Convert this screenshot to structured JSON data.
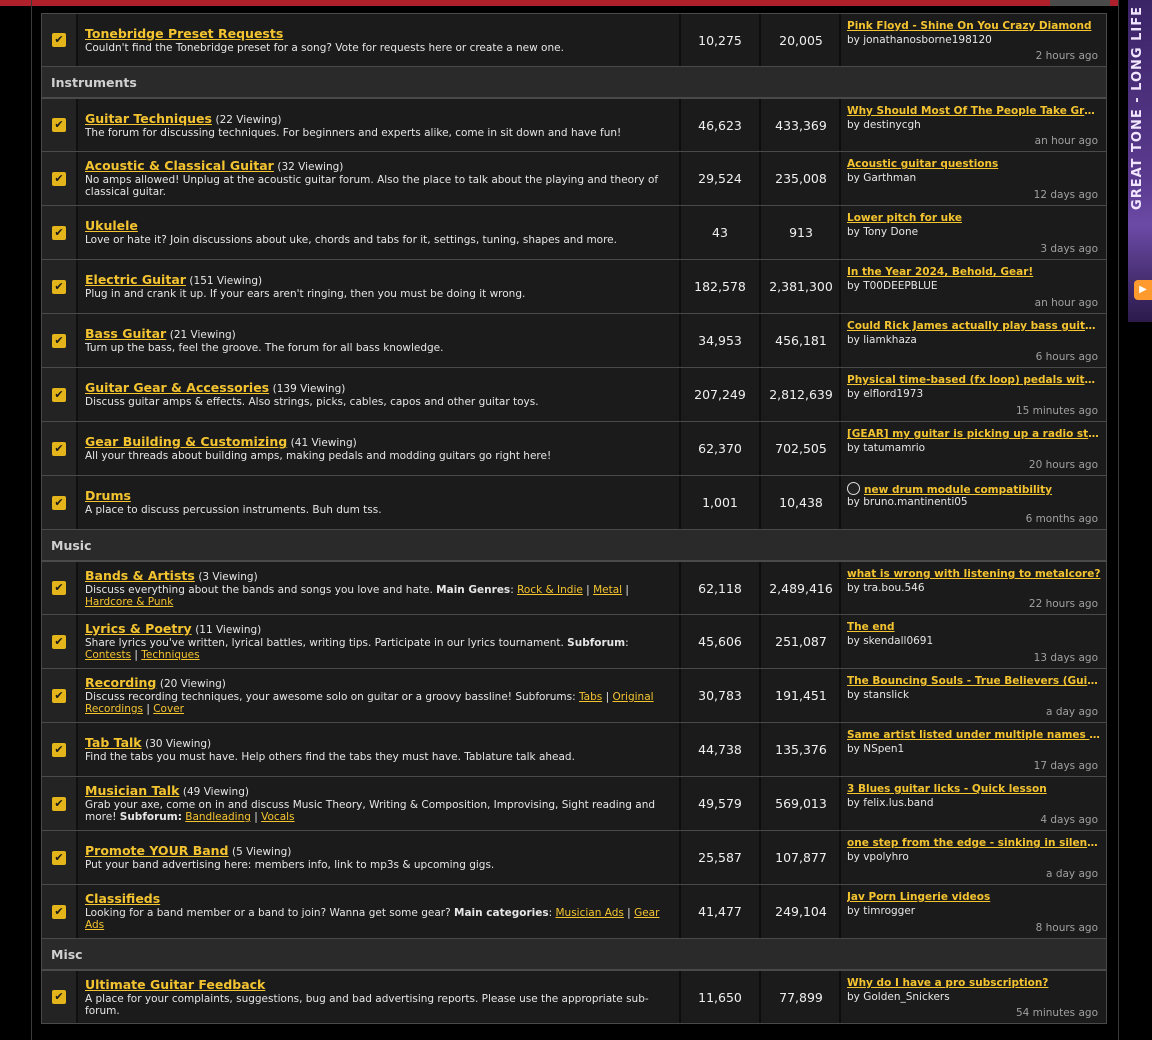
{
  "ad": {
    "text": "GREAT TONE - LONG LIFE"
  },
  "sections": [
    {
      "category": "",
      "forums": [
        {
          "title": "Tonebridge Preset Requests",
          "viewing": "",
          "desc": "Couldn't find the Tonebridge preset for a song? Vote for requests here or create a new one.",
          "threads": "10,275",
          "posts": "20,005",
          "last_title": "Pink Floyd - Shine On You Crazy Diamond",
          "last_by": "by jonathanosborne198120",
          "last_time": "2 hours ago"
        }
      ]
    },
    {
      "category": "Instruments",
      "forums": [
        {
          "title": "Guitar Techniques",
          "viewing": "(22 Viewing)",
          "desc": "The forum for discussing techniques. For beginners and experts alike, come in sit down and have fun!",
          "threads": "46,623",
          "posts": "433,369",
          "last_title": "Why Should Most Of The People Take Gro...",
          "last_by": "by destinycgh",
          "last_time": "an hour ago"
        },
        {
          "title": "Acoustic & Classical Guitar",
          "viewing": "(32 Viewing)",
          "desc": "No amps allowed! Unplug at the acoustic guitar forum. Also the place to talk about the playing and theory of classical guitar.",
          "threads": "29,524",
          "posts": "235,008",
          "last_title": "Acoustic guitar questions",
          "last_by": "by Garthman",
          "last_time": "12 days ago"
        },
        {
          "title": "Ukulele",
          "viewing": "",
          "desc": "Love or hate it? Join discussions about uke, chords and tabs for it, settings, tuning, shapes and more.",
          "threads": "43",
          "posts": "913",
          "last_title": "Lower pitch for uke",
          "last_by": "by Tony Done",
          "last_time": "3 days ago"
        },
        {
          "title": "Electric Guitar",
          "viewing": "(151 Viewing)",
          "desc": "Plug in and crank it up. If your ears aren't ringing, then you must be doing it wrong.",
          "threads": "182,578",
          "posts": "2,381,300",
          "last_title": "In the Year 2024, Behold, Gear!",
          "last_by": "by T00DEEPBLUE",
          "last_time": "an hour ago"
        },
        {
          "title": "Bass Guitar",
          "viewing": "(21 Viewing)",
          "desc": "Turn up the bass, feel the groove. The forum for all bass knowledge.",
          "threads": "34,953",
          "posts": "456,181",
          "last_title": "Could Rick James actually play bass guitar?",
          "last_by": "by liamkhaza",
          "last_time": "6 hours ago"
        },
        {
          "title": "Guitar Gear & Accessories",
          "viewing": "(139 Viewing)",
          "desc": "Discuss guitar amps & effects. Also strings, picks, cables, capos and other guitar toys.",
          "threads": "207,249",
          "posts": "2,812,639",
          "last_title": "Physical time-based (fx loop) pedals with ...",
          "last_by": "by elflord1973",
          "last_time": "15 minutes ago"
        },
        {
          "title": "Gear Building & Customizing",
          "viewing": "(41 Viewing)",
          "desc": "All your threads about building amps, making pedals and modding guitars go right here!",
          "threads": "62,370",
          "posts": "702,505",
          "last_title": "[GEAR] my guitar is picking up a radio stat...",
          "last_by": "by tatumamrio",
          "last_time": "20 hours ago"
        },
        {
          "title": "Drums",
          "viewing": "",
          "desc": "A place to discuss percussion instruments. Buh dum tss.",
          "threads": "1,001",
          "posts": "10,438",
          "last_title": "new drum module compatibility",
          "last_by": "by bruno.mantinenti05",
          "last_time": "6 months ago",
          "smiley": true
        }
      ]
    },
    {
      "category": "Music",
      "forums": [
        {
          "title": "Bands & Artists",
          "viewing": "(3 Viewing)",
          "desc": "Discuss everything about the bands and songs you love and hate.",
          "extra": [
            {
              "b": "Main Genres"
            },
            {
              "t": ": "
            },
            {
              "a": "Rock & Indie"
            },
            {
              "t": " | "
            },
            {
              "a": "Metal"
            },
            {
              "t": " | "
            },
            {
              "a": "Hardcore & Punk"
            }
          ],
          "threads": "62,118",
          "posts": "2,489,416",
          "last_title": "what is wrong with listening to metalcore?",
          "last_by": "by tra.bou.546",
          "last_time": "22 hours ago"
        },
        {
          "title": "Lyrics & Poetry",
          "viewing": "(11 Viewing)",
          "desc": "Share lyrics you've written, lyrical battles, writing tips. Participate in our lyrics tournament.",
          "extra": [
            {
              "b": "Subforum"
            },
            {
              "t": ": "
            },
            {
              "a": "Contests"
            },
            {
              "t": " | "
            },
            {
              "a": "Techniques"
            }
          ],
          "threads": "45,606",
          "posts": "251,087",
          "last_title": "The end",
          "last_by": "by skendall0691",
          "last_time": "13 days ago"
        },
        {
          "title": "Recording",
          "viewing": "(20 Viewing)",
          "desc": "Discuss recording techniques, your awesome solo on guitar or a groovy bassline! Subforums:",
          "extra": [
            {
              "a": "Tabs"
            },
            {
              "t": " | "
            },
            {
              "a": "Original Recordings"
            },
            {
              "t": " | "
            },
            {
              "a": "Cover"
            }
          ],
          "threads": "30,783",
          "posts": "191,451",
          "last_title": "The Bouncing Souls - True Believers (Guita...",
          "last_by": "by stanslick",
          "last_time": "a day ago"
        },
        {
          "title": "Tab Talk",
          "viewing": "(30 Viewing)",
          "desc": "Find the tabs you must have. Help others find the tabs they must have. Tablature talk ahead.",
          "threads": "44,738",
          "posts": "135,376",
          "last_title": "Same artist listed under multiple names - ...",
          "last_by": "by NSpen1",
          "last_time": "17 days ago"
        },
        {
          "title": "Musician Talk",
          "viewing": "(49 Viewing)",
          "desc": "Grab your axe, come on in and discuss Music Theory, Writing & Composition, Improvising, Sight reading and more!",
          "extra": [
            {
              "b": "Subforum:"
            },
            {
              "t": " "
            },
            {
              "a": "Bandleading"
            },
            {
              "t": " | "
            },
            {
              "a": "Vocals"
            }
          ],
          "threads": "49,579",
          "posts": "569,013",
          "last_title": "3 Blues guitar licks - Quick lesson",
          "last_by": "by felix.lus.band",
          "last_time": "4 days ago"
        },
        {
          "title": "Promote YOUR Band",
          "viewing": "(5 Viewing)",
          "desc": "Put your band advertising here: members info, link to mp3s & upcoming gigs.",
          "threads": "25,587",
          "posts": "107,877",
          "last_title": "one step from the edge - sinking in silence...",
          "last_by": "by vpolyhro",
          "last_time": "a day ago"
        },
        {
          "title": "Classifieds",
          "viewing": "",
          "desc": "Looking for a band member or a band to join? Wanna get some gear?",
          "extra": [
            {
              "b": "Main categories"
            },
            {
              "t": ": "
            },
            {
              "a": "Musician Ads"
            },
            {
              "t": " | "
            },
            {
              "a": "Gear Ads"
            }
          ],
          "threads": "41,477",
          "posts": "249,104",
          "last_title": "Jav Porn Lingerie videos",
          "last_by": "by timrogger",
          "last_time": "8 hours ago"
        }
      ]
    },
    {
      "category": "Misc",
      "forums": [
        {
          "title": "Ultimate Guitar Feedback",
          "viewing": "",
          "desc": "A place for your complaints, suggestions, bug and bad advertising reports. Please use the appropriate sub-forum.",
          "threads": "11,650",
          "posts": "77,899",
          "last_title": "Why do I have a pro subscription?",
          "last_by": "by Golden_Snickers",
          "last_time": "54 minutes ago"
        }
      ]
    }
  ]
}
